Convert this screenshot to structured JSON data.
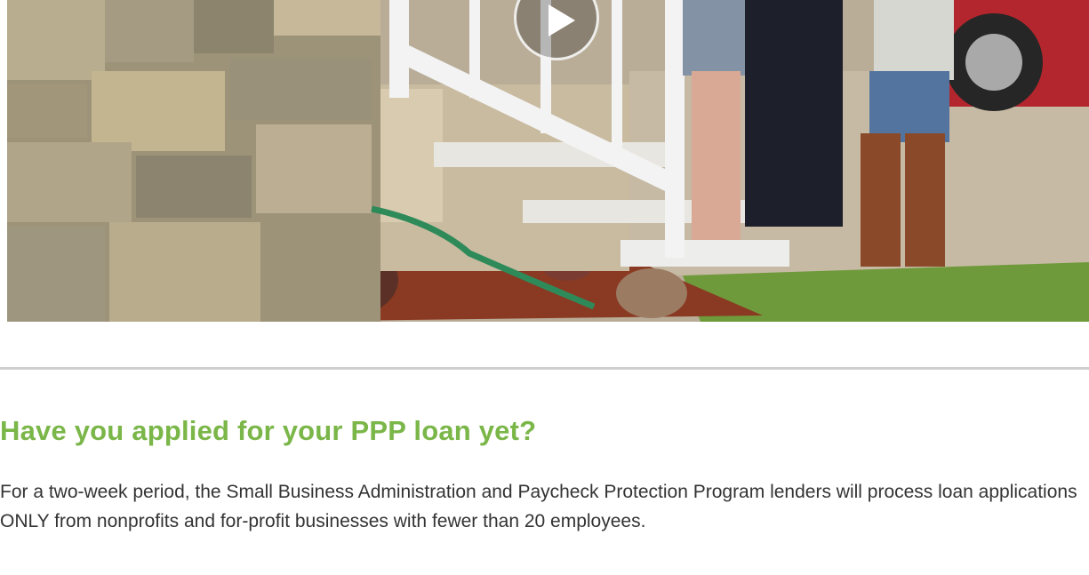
{
  "video": {
    "play_icon": "play-icon",
    "play_label": "Play video"
  },
  "article": {
    "heading": "Have you applied for your PPP loan yet?",
    "body": "For a two-week period, the Small Business Administration and Paycheck Protection Program lenders will process loan applications ONLY from nonprofits and for-profit businesses with fewer than 20 employees."
  },
  "colors": {
    "heading": "#7ab648",
    "body_text": "#333333",
    "divider": "#cfcfcf"
  }
}
